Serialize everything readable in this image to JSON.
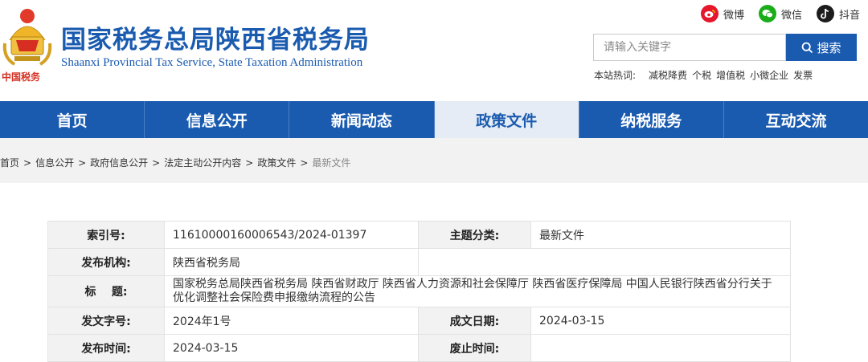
{
  "header": {
    "title": "国家税务总局陕西省税务局",
    "subtitle": "Shaanxi Provincial Tax Service, State Taxation Administration",
    "emblem_text": "中国税务",
    "social": [
      {
        "label": "微博",
        "icon": "weibo-icon"
      },
      {
        "label": "微信",
        "icon": "wechat-icon"
      },
      {
        "label": "抖音",
        "icon": "douyin-icon"
      }
    ],
    "search": {
      "placeholder": "请输入关键字",
      "button_label": "搜索"
    },
    "hotwords": {
      "label": "本站热词:",
      "items": [
        "减税降费",
        "个税",
        "增值税",
        "小微企业",
        "发票"
      ]
    }
  },
  "nav": {
    "items": [
      "首页",
      "信息公开",
      "新闻动态",
      "政策文件",
      "纳税服务",
      "互动交流"
    ],
    "active": "政策文件"
  },
  "breadcrumb": [
    "首页",
    "信息公开",
    "政府信息公开",
    "法定主动公开内容",
    "政策文件",
    "最新文件"
  ],
  "info": {
    "index_no_label": "索引号:",
    "index_no": "11610000160006543/2024-01397",
    "topic_label": "主题分类:",
    "topic": "最新文件",
    "publisher_label": "发布机构:",
    "publisher": "陕西省税务局",
    "title_label": "标    题:",
    "title": "国家税务总局陕西省税务局 陕西省财政厅 陕西省人力资源和社会保障厅 陕西省医疗保障局 中国人民银行陕西省分行关于优化调整社会保险费申报缴纳流程的公告",
    "doc_no_label": "发文字号:",
    "doc_no": "2024年1号",
    "created_label": "成文日期:",
    "created": "2024-03-15",
    "published_label": "发布时间:",
    "published": "2024-03-15",
    "abolished_label": "废止时间:",
    "abolished": ""
  },
  "colors": {
    "brand_blue": "#1a5bb0",
    "nav_active_bg": "#e6ecf5",
    "label_bg": "#f2f2f2"
  }
}
